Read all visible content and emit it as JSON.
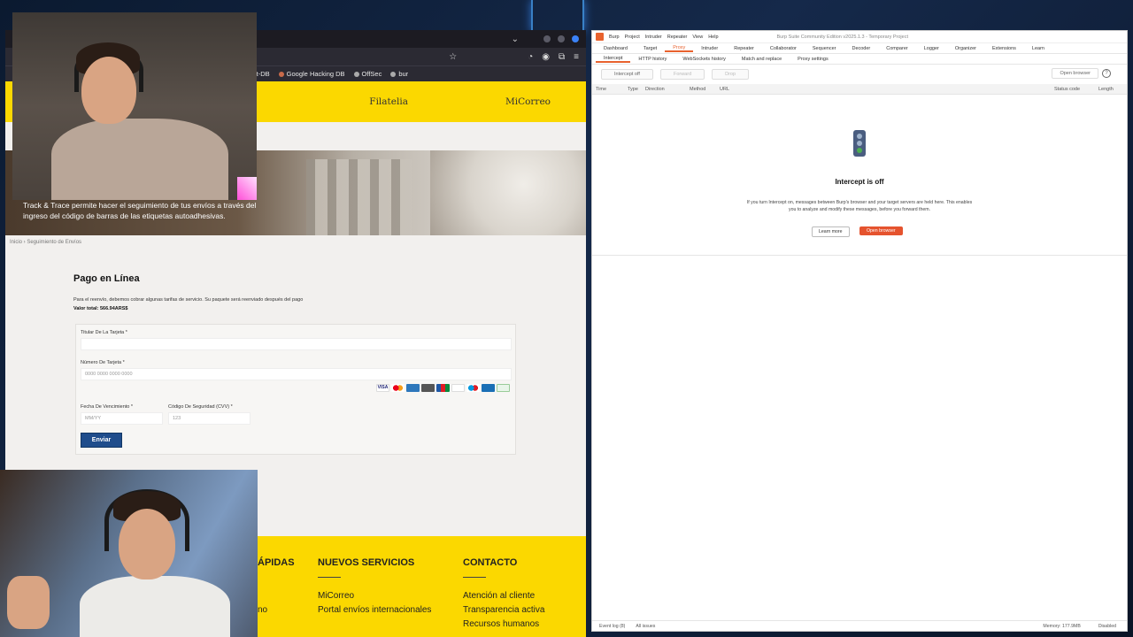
{
  "browser": {
    "bookmarks": [
      "it-DB",
      "Google Hacking DB",
      "OffSec",
      "bur"
    ],
    "site_nav": [
      "Filatelia",
      "MiCorreo"
    ],
    "hero_text": "Track & Trace permite hacer el seguimiento de tus envíos a través del ingreso del código de barras de las etiquetas autoadhesivas.",
    "breadcrumb": "Inicio › Seguimiento de Envíos",
    "payment": {
      "title": "Pago en Línea",
      "description": "Para el reenvío, debemos cobrar algunas tarifas de servicio. Su paquete será reenviado después del pago",
      "total": "Valor total: 566.94ARS$",
      "holder_label": "Titular De La Tarjeta *",
      "holder_value": "",
      "card_label": "Número De Tarjeta *",
      "card_placeholder": "0000 0000 0000 0000",
      "expiry_label": "Fecha De Vencimiento *",
      "expiry_placeholder": "MM/YY",
      "cvv_label": "Código De Seguridad (CVV) *",
      "cvv_placeholder": "123",
      "submit": "Enviar",
      "card_brands": [
        "visa",
        "mastercard",
        "amex",
        "discover",
        "jcb",
        "diners",
        "maestro",
        "union",
        "generic"
      ]
    },
    "footer": {
      "col1_title": "ÁPIDAS",
      "col1_link": "no",
      "col2_title": "NUEVOS SERVICIOS",
      "col2_links": [
        "MiCorreo",
        "Portal envíos internacionales"
      ],
      "col3_title": "CONTACTO",
      "col3_links": [
        "Atención al cliente",
        "Transparencia activa",
        "Recursos humanos"
      ]
    }
  },
  "burp": {
    "title": "Burp Suite Community Edition v2025.1.3 - Temporary Project",
    "menu": [
      "Burp",
      "Project",
      "Intruder",
      "Repeater",
      "View",
      "Help"
    ],
    "tabs": [
      "Dashboard",
      "Target",
      "Proxy",
      "Intruder",
      "Repeater",
      "Collaborator",
      "Sequencer",
      "Decoder",
      "Comparer",
      "Logger",
      "Organizer",
      "Extensions",
      "Learn"
    ],
    "active_tab": "Proxy",
    "subtabs": [
      "Intercept",
      "HTTP history",
      "WebSockets history",
      "Match and replace",
      "Proxy settings"
    ],
    "toolbar": {
      "intercept": "Intercept off",
      "forward": "Forward",
      "drop": "Drop",
      "open_browser": "Open browser"
    },
    "columns": [
      "Time",
      "Type",
      "Direction",
      "Method",
      "URL",
      "Status code",
      "Length"
    ],
    "empty_title": "Intercept is off",
    "empty_text": "If you turn Intercept on, messages between Burp's browser and your target servers are held here. This enables you to analyze and modify these messages, before you forward them.",
    "learn_more": "Learn more",
    "open_browser_btn": "Open browser",
    "status": {
      "event_log": "Event log (8)",
      "all_issues": "All issues",
      "memory": "Memory: 177.9MB",
      "disabled": "Disabled"
    }
  },
  "colors": {
    "site_yellow": "#fbd800",
    "submit_blue": "#1f4d8c",
    "burp_orange": "#e8622e"
  }
}
